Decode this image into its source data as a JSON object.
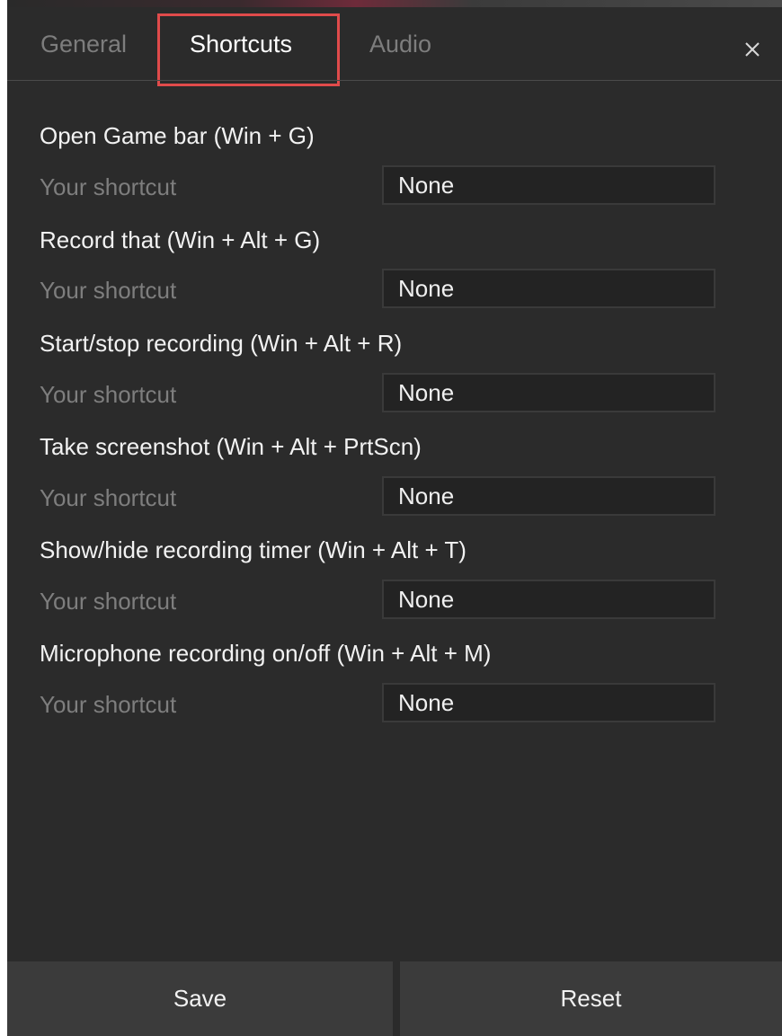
{
  "tabs": {
    "general": "General",
    "shortcuts": "Shortcuts",
    "audio": "Audio",
    "active": "Shortcuts"
  },
  "close_icon": "close-icon",
  "shortcuts": [
    {
      "title": "Open Game bar (Win + G)",
      "sub_label": "Your shortcut",
      "value": "None"
    },
    {
      "title": "Record that (Win + Alt + G)",
      "sub_label": "Your shortcut",
      "value": "None"
    },
    {
      "title": "Start/stop recording (Win + Alt + R)",
      "sub_label": "Your shortcut",
      "value": "None"
    },
    {
      "title": "Take screenshot (Win + Alt + PrtScn)",
      "sub_label": "Your shortcut",
      "value": "None"
    },
    {
      "title": "Show/hide recording timer (Win + Alt + T)",
      "sub_label": "Your shortcut",
      "value": "None"
    },
    {
      "title": "Microphone recording on/off (Win + Alt + M)",
      "sub_label": "Your shortcut",
      "value": "None"
    }
  ],
  "footer": {
    "save_label": "Save",
    "reset_label": "Reset"
  },
  "colors": {
    "panel_bg": "#2b2b2b",
    "tab_highlight": "#e04b4b",
    "button_bg": "#3b3b3b"
  }
}
